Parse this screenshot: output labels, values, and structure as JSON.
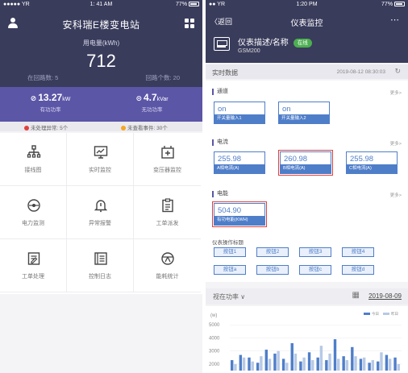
{
  "left": {
    "status": {
      "signal": "●●●●● YR",
      "time": "1: 41 AM",
      "battery": "77%"
    },
    "title": "安科瑞E楼变电站",
    "usage_label": "用电量(kWh)",
    "usage_value": "712",
    "circuits_left": "在回路数: 5",
    "circuits_right": "回路个数: 20",
    "active_value": "13.27",
    "active_unit": "kW",
    "active_label": "有功功率",
    "reactive_value": "4.7",
    "reactive_unit": "kVar",
    "reactive_label": "无功功率",
    "alert_unhandled": "未处理异常: 5个",
    "alert_unviewed": "未查看事件: 30个",
    "menu": [
      {
        "label": "接线图",
        "icon": "wiring-diagram-icon"
      },
      {
        "label": "实时监控",
        "icon": "realtime-monitor-icon"
      },
      {
        "label": "变压器监控",
        "icon": "transformer-icon"
      },
      {
        "label": "电力监测",
        "icon": "power-monitor-icon"
      },
      {
        "label": "异常报警",
        "icon": "alarm-bell-icon"
      },
      {
        "label": "工单派发",
        "icon": "clipboard-icon"
      },
      {
        "label": "工单处理",
        "icon": "edit-doc-icon"
      },
      {
        "label": "控制日志",
        "icon": "log-icon"
      },
      {
        "label": "能耗统计",
        "icon": "energy-stats-icon"
      }
    ],
    "colors": {
      "header": "#3a3c5c",
      "power_band": "#5b56a6",
      "alert_red": "#e0413e",
      "alert_orange": "#f5a623"
    }
  },
  "right": {
    "status": {
      "signal": "●● YR",
      "time": "1:20 PM",
      "battery": "77%"
    },
    "back_label": "返回",
    "nav_title": "仪表监控",
    "more_icon": "⋯",
    "meter_name": "仪表描述/名称",
    "online_badge": "在线",
    "meter_code": "GSM200",
    "realtime_label": "实时数据",
    "timestamp": "2019-08-12 08:30:03",
    "more_link": "更多>",
    "channel": {
      "title": "通道",
      "items": [
        {
          "value": "on",
          "label": "开关量输入1"
        },
        {
          "value": "on",
          "label": "开关量输入2"
        }
      ]
    },
    "current": {
      "title": "电流",
      "items": [
        {
          "value": "255.98",
          "label": "A相电流(A)"
        },
        {
          "value": "260.98",
          "label": "B相电流(A)"
        },
        {
          "value": "255.98",
          "label": "C相电流(A)"
        }
      ]
    },
    "energy": {
      "title": "电能",
      "items": [
        {
          "value": "504.90",
          "label": "有功电能(KWH)"
        }
      ]
    },
    "ops_title": "仪表操作标题",
    "ops": [
      "按钮1",
      "按钮2",
      "按钮3",
      "按钮4",
      "按钮a",
      "按钮b",
      "按钮c",
      "按钮d"
    ],
    "chart_selector": "视在功率 ∨",
    "chart_date": "2019-08-09",
    "colors": {
      "header": "#3a3c5c",
      "box_blue": "#4f7ec9",
      "highlight_red": "#e0413e",
      "online_green": "#4caf50"
    }
  },
  "chart_data": {
    "type": "bar",
    "ylabel": "(w)",
    "yticks": [
      5000,
      4000,
      3000,
      2000
    ],
    "ylim": [
      1500,
      5200
    ],
    "legend": [
      "今日",
      "昨日"
    ],
    "series": [
      {
        "name": "今日",
        "color": "#4f7ec9",
        "values": [
          2300,
          2700,
          2500,
          2100,
          3100,
          2800,
          2400,
          3600,
          2200,
          2900,
          2500,
          2300,
          3900,
          2600,
          3300,
          2400,
          2100,
          2200,
          2700,
          2500
        ]
      },
      {
        "name": "昨日",
        "color": "#b7c9e6",
        "values": [
          2000,
          2500,
          2200,
          2600,
          2400,
          3000,
          2100,
          2800,
          2500,
          2300,
          3400,
          2800,
          2400,
          2300,
          2600,
          2500,
          2300,
          2900,
          2400,
          2000
        ]
      }
    ]
  }
}
